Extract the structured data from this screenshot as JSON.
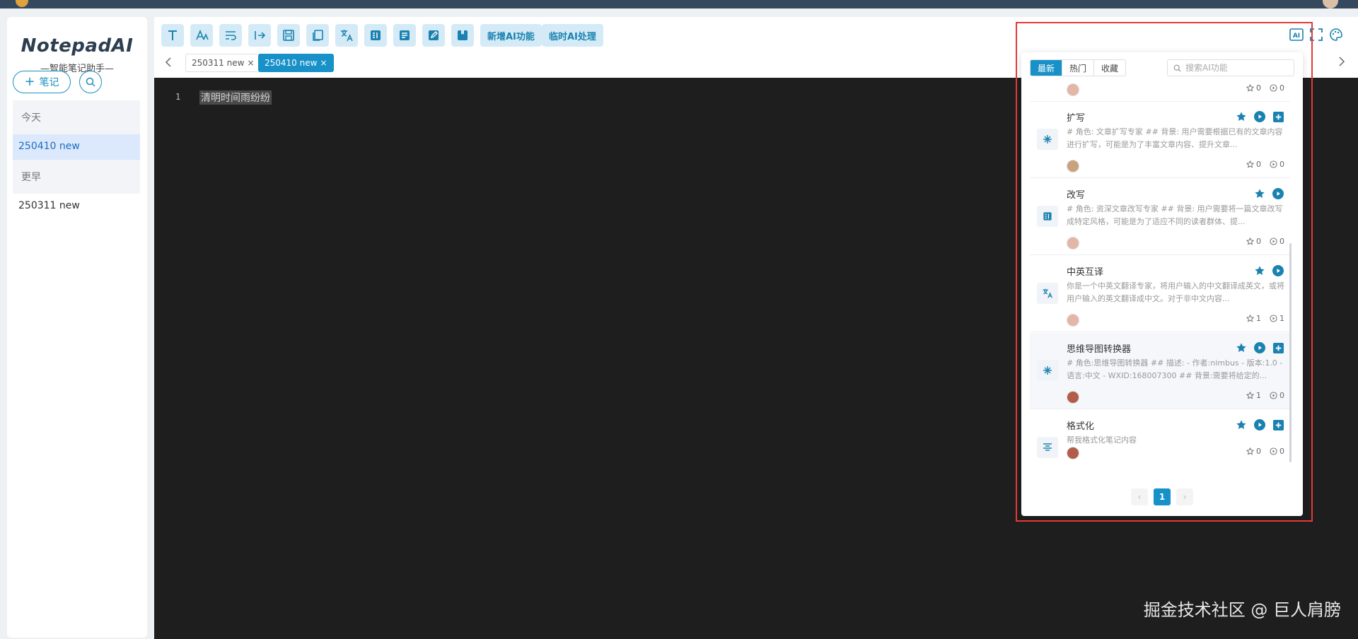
{
  "brand": {
    "title": "NotepadAI",
    "subtitle": "—智能笔记助手—"
  },
  "sidebar": {
    "new_note_label": "笔记",
    "groups": [
      {
        "label": "今天",
        "notes": [
          "250410 new"
        ]
      },
      {
        "label": "更早",
        "notes": [
          "250311 new"
        ]
      }
    ]
  },
  "toolbar": {
    "icons": [
      "text-icon",
      "font-size-icon",
      "wrap-icon",
      "indent-icon",
      "save-icon",
      "copy-icon",
      "translate-icon",
      "summary-icon",
      "document-icon",
      "edit-icon",
      "bookmark-icon"
    ],
    "add_ai_label": "新增AI功能",
    "temp_ai_label": "临时AI处理"
  },
  "tabs": [
    {
      "label": "250311 new",
      "active": false
    },
    {
      "label": "250410 new",
      "active": true
    }
  ],
  "editor": {
    "line_number": "1",
    "line_text": "清明时间雨纷纷"
  },
  "watermark": "掘金技术社区 @ 巨人肩膀",
  "ai_panel": {
    "filters": [
      "最新",
      "热门",
      "收藏"
    ],
    "active_filter": "最新",
    "search_placeholder": "搜索AI功能",
    "cards": [
      {
        "title": "扩写",
        "icon": "sparkle-icon",
        "desc": "# 角色: 文章扩写专家 ## 背景: 用户需要根据已有的文章内容进行扩写，可能是为了丰富文章内容、提升文章...",
        "stars": "0",
        "runs": "0",
        "has_add": true
      },
      {
        "title": "改写",
        "icon": "summary-icon",
        "desc": "# 角色: 资深文章改写专家 ## 背景: 用户需要将一篇文章改写成特定风格，可能是为了适应不同的读者群体、提...",
        "stars": "0",
        "runs": "0",
        "has_add": false
      },
      {
        "title": "中英互译",
        "icon": "translate-icon",
        "desc": "你是一个中英文翻译专家，将用户输入的中文翻译成英文，或将用户输入的英文翻译成中文。对于非中文内容...",
        "stars": "1",
        "runs": "1",
        "has_add": false
      },
      {
        "title": "思维导图转换器",
        "icon": "sparkle-icon",
        "desc": "# 角色:思维导图转换器 ## 描述: - 作者:nimbus - 版本:1.0 - 语言:中文 - WXID:168007300 ## 背景:需要将给定的...",
        "stars": "1",
        "runs": "0",
        "has_add": true
      },
      {
        "title": "格式化",
        "icon": "format-icon",
        "desc": "帮我格式化笔记内容",
        "stars": "0",
        "runs": "0",
        "has_add": true
      }
    ],
    "partial_top_stats": {
      "stars": "0",
      "runs": "0"
    },
    "page": "1"
  },
  "colors": {
    "accent": "#1890c8",
    "highlight_frame": "#e53935",
    "editor_bg": "#1e1e1e"
  }
}
